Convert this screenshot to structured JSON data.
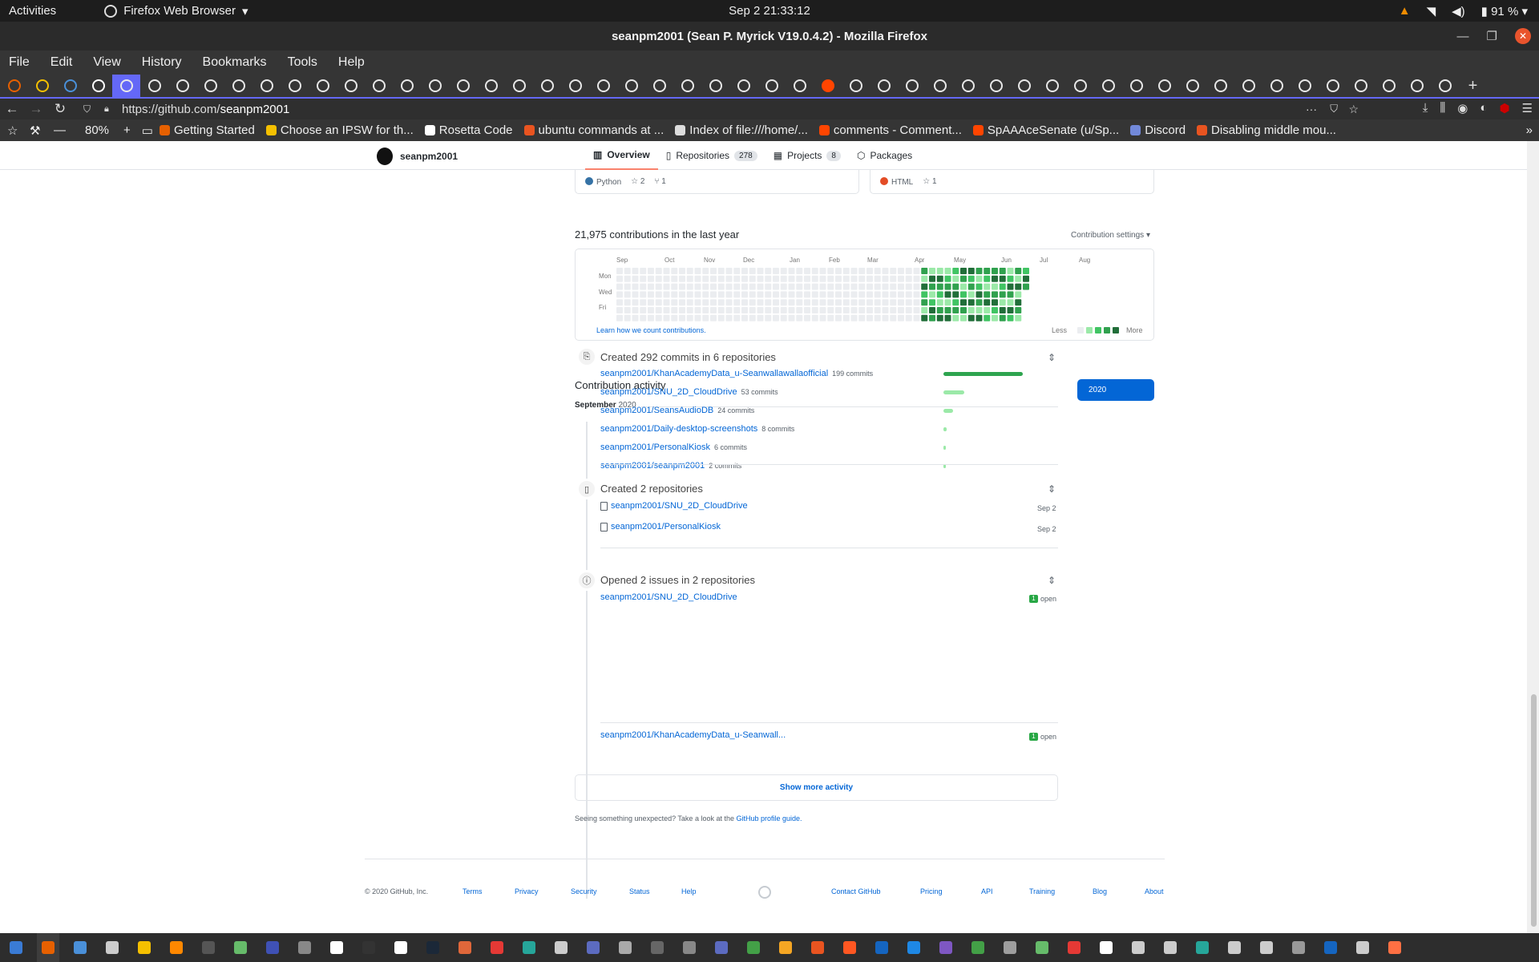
{
  "system": {
    "activities": "Activities",
    "app_name": "Firefox Web Browser",
    "clock": "Sep 2  21:33:12",
    "battery": "91 %"
  },
  "window": {
    "title": "seanpm2001 (Sean P. Myrick V19.0.4.2) - Mozilla Firefox"
  },
  "menu": [
    "File",
    "Edit",
    "View",
    "History",
    "Bookmarks",
    "Tools",
    "Help"
  ],
  "url": {
    "prefix": "https://github.com/",
    "path": "seanpm2001"
  },
  "zoom": "80%",
  "bookmarks": [
    {
      "label": "Getting Started",
      "color": "#e66000"
    },
    {
      "label": "Choose an IPSW for th...",
      "color": "#f5c000"
    },
    {
      "label": "Rosetta Code",
      "color": "#ffffff"
    },
    {
      "label": "ubuntu commands at ...",
      "color": "#e95420"
    },
    {
      "label": "Index of file:///home/...",
      "color": "#dddddd"
    },
    {
      "label": "comments - Comment...",
      "color": "#ff4500"
    },
    {
      "label": "SpAAAceSenate (u/Sp...",
      "color": "#ff4500"
    },
    {
      "label": "Discord",
      "color": "#7289da"
    },
    {
      "label": "Disabling middle mou...",
      "color": "#e95420"
    }
  ],
  "profile": {
    "username": "seanpm2001",
    "tabs": [
      {
        "label": "Overview",
        "count": ""
      },
      {
        "label": "Repositories",
        "count": "278"
      },
      {
        "label": "Projects",
        "count": "8"
      },
      {
        "label": "Packages",
        "count": ""
      }
    ]
  },
  "pinned_cards": [
    {
      "language": "Python",
      "lang_color": "#3572A5",
      "stars": "2",
      "forks": "1"
    },
    {
      "language": "HTML",
      "lang_color": "#e34c26",
      "stars": "1",
      "forks": ""
    }
  ],
  "contributions": {
    "title": "21,975 contributions in the last year",
    "settings": "Contribution settings ▾",
    "months": [
      "Sep",
      "Oct",
      "Nov",
      "Dec",
      "Jan",
      "Feb",
      "Mar",
      "Apr",
      "May",
      "Jun",
      "Jul",
      "Aug"
    ],
    "days": [
      "Mon",
      "Wed",
      "Fri"
    ],
    "learn": "Learn how we count contributions.",
    "less": "Less",
    "more": "More",
    "colors": [
      "#ebedf0",
      "#9be9a8",
      "#40c463",
      "#30a14e",
      "#216e39"
    ]
  },
  "activity": {
    "title": "Contribution activity",
    "year": "2020",
    "month_label": "September",
    "month_year": "2020",
    "commits": {
      "title": "Created 292 commits in 6 repositories",
      "max": 199,
      "rows": [
        {
          "repo": "seanpm2001/KhanAcademyData_u-Seanwallawallaofficial",
          "commits": "199 commits",
          "n": 199
        },
        {
          "repo": "seanpm2001/SNU_2D_CloudDrive",
          "commits": "53 commits",
          "n": 53
        },
        {
          "repo": "seanpm2001/SeansAudioDB",
          "commits": "24 commits",
          "n": 24
        },
        {
          "repo": "seanpm2001/Daily-desktop-screenshots",
          "commits": "8 commits",
          "n": 8
        },
        {
          "repo": "seanpm2001/PersonalKiosk",
          "commits": "6 commits",
          "n": 6
        },
        {
          "repo": "seanpm2001/seanpm2001",
          "commits": "2 commits",
          "n": 2
        }
      ]
    },
    "repos": {
      "title": "Created 2 repositories",
      "rows": [
        {
          "repo": "seanpm2001/SNU_2D_CloudDrive",
          "date": "Sep 2"
        },
        {
          "repo": "seanpm2001/PersonalKiosk",
          "date": "Sep 2"
        }
      ]
    },
    "issues": {
      "title": "Opened 2 issues in 2 repositories",
      "rows": [
        {
          "repo": "seanpm2001/SNU_2D_CloudDrive",
          "count": "1",
          "state": "open"
        },
        {
          "repo": "seanpm2001/KhanAcademyData_u-Seanwall...",
          "count": "1",
          "state": "open"
        }
      ]
    },
    "show_more": "Show more activity",
    "unexpected": "Seeing something unexpected? Take a look at the",
    "guide_link": "GitHub profile guide."
  },
  "footer": {
    "copyright": "© 2020 GitHub, Inc.",
    "links_left": [
      "Terms",
      "Privacy",
      "Security",
      "Status",
      "Help"
    ],
    "links_right": [
      "Contact GitHub",
      "Pricing",
      "API",
      "Training",
      "Blog",
      "About"
    ]
  },
  "taskbar_colors": [
    "#3a7bd5",
    "#e66000",
    "#4a90d9",
    "#cccccc",
    "#f5c000",
    "#ff8800",
    "#555555",
    "#66bb6a",
    "#3f51b5",
    "#888888",
    "#ffffff",
    "#333333",
    "#ffffff",
    "#1b2838",
    "#e0673a",
    "#e53935",
    "#26a69a",
    "#cccccc",
    "#5c6bc0",
    "#aaaaaa",
    "#666666",
    "#888888",
    "#5c6bc0",
    "#43a047",
    "#f5a623",
    "#e95420",
    "#ff5722",
    "#1565c0",
    "#1e88e5",
    "#7e57c2",
    "#43a047",
    "#9e9e9e",
    "#66bb6a",
    "#e53935",
    "#ffffff",
    "#cccccc",
    "#cccccc",
    "#26a69a",
    "#cccccc",
    "#cccccc",
    "#999999",
    "#1565c0",
    "#cccccc",
    "#ff7043"
  ]
}
